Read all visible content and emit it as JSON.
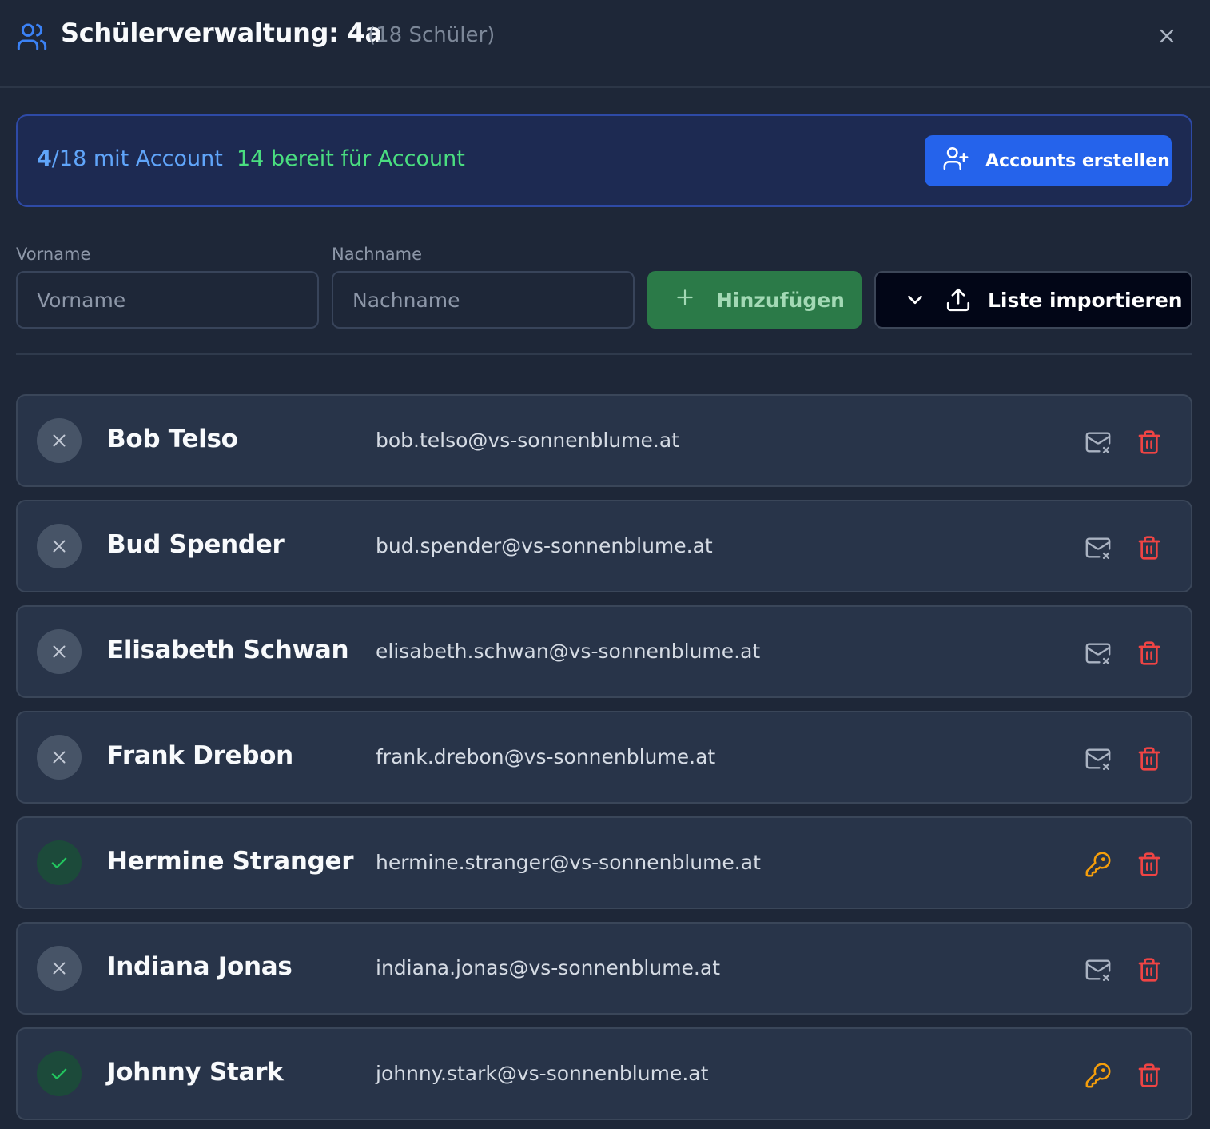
{
  "header": {
    "title": "Schülerverwaltung: 4a",
    "count": "(18 Schüler)",
    "icon": "users-icon",
    "accent": "#3b82f6"
  },
  "banner": {
    "with_account_count": "4",
    "with_account_rest": "/18 mit Account",
    "ready_text": "14 bereit für Account",
    "create_button": "Accounts erstellen"
  },
  "form": {
    "firstname_label": "Vorname",
    "firstname_placeholder": "Vorname",
    "lastname_label": "Nachname",
    "lastname_placeholder": "Nachname",
    "add_button": "Hinzufügen",
    "import_button": "Liste importieren"
  },
  "students": [
    {
      "name": "Bob Telso",
      "email": "bob.telso@vs-sonnenblume.at",
      "has_account": false
    },
    {
      "name": "Bud Spender",
      "email": "bud.spender@vs-sonnenblume.at",
      "has_account": false
    },
    {
      "name": "Elisabeth Schwan",
      "email": "elisabeth.schwan@vs-sonnenblume.at",
      "has_account": false
    },
    {
      "name": "Frank Drebon",
      "email": "frank.drebon@vs-sonnenblume.at",
      "has_account": false
    },
    {
      "name": "Hermine Stranger",
      "email": "hermine.stranger@vs-sonnenblume.at",
      "has_account": true
    },
    {
      "name": "Indiana Jonas",
      "email": "indiana.jonas@vs-sonnenblume.at",
      "has_account": false
    },
    {
      "name": "Johnny Stark",
      "email": "johnny.stark@vs-sonnenblume.at",
      "has_account": true
    }
  ],
  "colors": {
    "background": "#1e2738",
    "primary": "#2563eb",
    "success": "#4ade80",
    "danger": "#ef4444",
    "key": "#f59e0b"
  }
}
